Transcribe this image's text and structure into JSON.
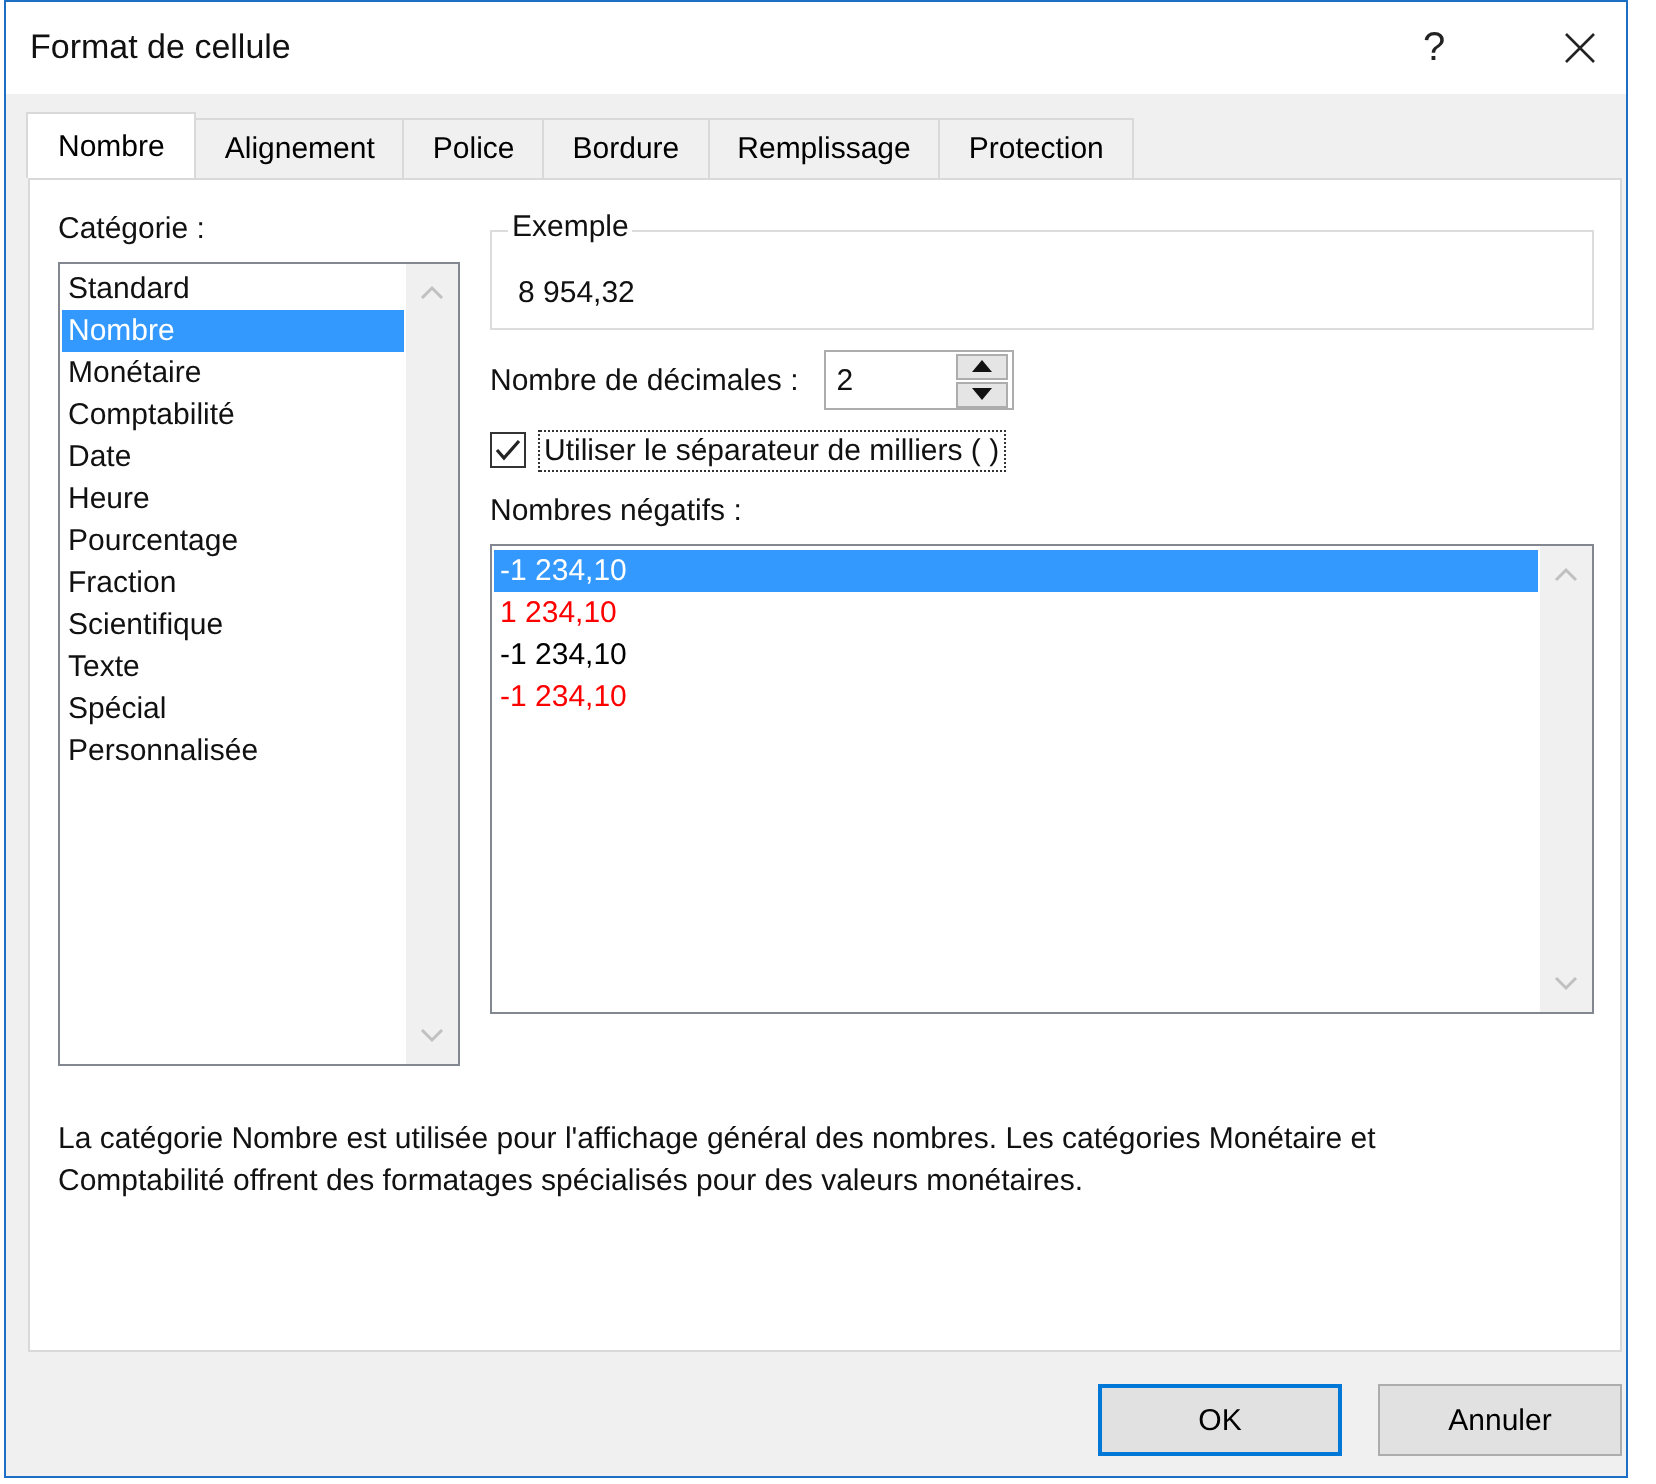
{
  "window": {
    "title": "Format de cellule",
    "help": "?"
  },
  "tabs": [
    {
      "label": "Nombre",
      "selected": true
    },
    {
      "label": "Alignement",
      "selected": false
    },
    {
      "label": "Police",
      "selected": false
    },
    {
      "label": "Bordure",
      "selected": false
    },
    {
      "label": "Remplissage",
      "selected": false
    },
    {
      "label": "Protection",
      "selected": false
    }
  ],
  "category": {
    "label": "Catégorie :",
    "items": [
      {
        "label": "Standard",
        "selected": false
      },
      {
        "label": "Nombre",
        "selected": true
      },
      {
        "label": "Monétaire",
        "selected": false
      },
      {
        "label": "Comptabilité",
        "selected": false
      },
      {
        "label": "Date",
        "selected": false
      },
      {
        "label": "Heure",
        "selected": false
      },
      {
        "label": "Pourcentage",
        "selected": false
      },
      {
        "label": "Fraction",
        "selected": false
      },
      {
        "label": "Scientifique",
        "selected": false
      },
      {
        "label": "Texte",
        "selected": false
      },
      {
        "label": "Spécial",
        "selected": false
      },
      {
        "label": "Personnalisée",
        "selected": false
      }
    ]
  },
  "sample": {
    "label": "Exemple",
    "value": "8 954,32"
  },
  "decimals": {
    "label": "Nombre de décimales :",
    "value": "2"
  },
  "thousands_separator": {
    "label": "Utiliser le séparateur de milliers ( )",
    "checked": true
  },
  "negative_numbers": {
    "label": "Nombres négatifs :",
    "items": [
      {
        "label": "-1 234,10",
        "selected": true
      },
      {
        "label": "1 234,10",
        "selected": false,
        "color": "#ff0000"
      },
      {
        "label": "-1 234,10",
        "selected": false,
        "color": "#000000"
      },
      {
        "label": "-1 234,10",
        "selected": false,
        "color": "#ff0000"
      }
    ]
  },
  "description": "La catégorie Nombre est utilisée pour l'affichage général des nombres. Les catégories Monétaire et Comptabilité offrent des formatages spécialisés pour des valeurs monétaires.",
  "buttons": [
    {
      "label": "OK",
      "default": true
    },
    {
      "label": "Annuler",
      "default": false
    }
  ]
}
